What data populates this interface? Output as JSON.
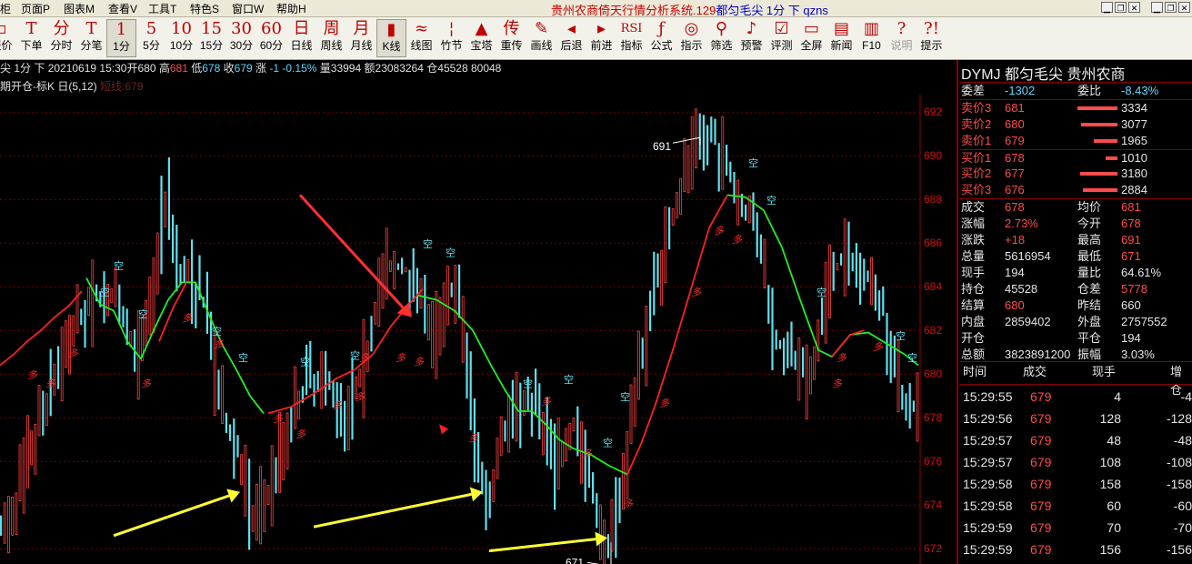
{
  "menu": [
    "柜",
    "页面P",
    "图表M",
    "查看V",
    "工具T",
    "特色S",
    "窗口W",
    "帮助H"
  ],
  "window_title": {
    "main": "贵州农商倚天行情分析系统.129",
    "contract": "都匀毛尖 1分 下 qzns"
  },
  "toolbar": {
    "buttons": [
      {
        "icon": "▫",
        "label": "报价",
        "name": "quote"
      },
      {
        "icon": "T",
        "label": "下单",
        "name": "order"
      },
      {
        "icon": "分",
        "label": "分时",
        "name": "intraday"
      },
      {
        "icon": "T",
        "label": "分笔",
        "name": "ticks"
      },
      {
        "icon": "1",
        "label": "1分",
        "name": "1min",
        "selected": true
      },
      {
        "icon": "5",
        "label": "5分",
        "name": "5min"
      },
      {
        "icon": "10",
        "label": "10分",
        "name": "10min"
      },
      {
        "icon": "15",
        "label": "15分",
        "name": "15min"
      },
      {
        "icon": "30",
        "label": "30分",
        "name": "30min"
      },
      {
        "icon": "60",
        "label": "60分",
        "name": "60min"
      },
      {
        "icon": "日",
        "label": "日线",
        "name": "daily"
      },
      {
        "icon": "周",
        "label": "周线",
        "name": "weekly"
      },
      {
        "icon": "月",
        "label": "月线",
        "name": "monthly"
      },
      {
        "icon": "▮",
        "label": "K线",
        "name": "kline",
        "selected": true
      },
      {
        "icon": "≈",
        "label": "线图",
        "name": "linechart"
      },
      {
        "icon": "¦",
        "label": "竹节",
        "name": "bamboo"
      },
      {
        "icon": "▲",
        "label": "宝塔",
        "name": "tower"
      },
      {
        "icon": "传",
        "label": "重传",
        "name": "reload"
      },
      {
        "icon": "✎",
        "label": "画线",
        "name": "draw"
      },
      {
        "icon": "◂",
        "label": "后退",
        "name": "back"
      },
      {
        "icon": "▸",
        "label": "前进",
        "name": "forward"
      },
      {
        "icon": "RSI",
        "label": "指标",
        "name": "indicator"
      },
      {
        "icon": "ƒ",
        "label": "公式",
        "name": "formula"
      },
      {
        "icon": "◎",
        "label": "指示",
        "name": "signal"
      },
      {
        "icon": "⚲",
        "label": "筛选",
        "name": "filter"
      },
      {
        "icon": "♪",
        "label": "预警",
        "name": "alert"
      },
      {
        "icon": "☑",
        "label": "评测",
        "name": "evaluate"
      },
      {
        "icon": "▭",
        "label": "全屏",
        "name": "fullscreen"
      },
      {
        "icon": "▤",
        "label": "新闻",
        "name": "news"
      },
      {
        "icon": "▥",
        "label": "F10",
        "name": "f10"
      },
      {
        "icon": "?",
        "label": "说明",
        "name": "explain",
        "disabled": true
      },
      {
        "icon": "?!",
        "label": "提示",
        "name": "tips"
      }
    ]
  },
  "infobar": {
    "prefix": "尖 1分 下",
    "date_time": "20210619 15:30",
    "open_label": "开",
    "open": "680",
    "high_label": "高",
    "high": "681",
    "low_label": "低",
    "low": "678",
    "close_label": "收",
    "close": "679",
    "change_label": "涨",
    "change": "-1",
    "change_pct": "-0.15%",
    "volume_label": "量",
    "volume": "33994",
    "amount_label": "额",
    "amount": "23083264",
    "oi_label": "仓",
    "oi": "45528",
    "extra": "80048"
  },
  "indicator_bar": {
    "label": "期开仓-标K 日(5,12)",
    "ghost": "短线:679"
  },
  "chart_data": {
    "type": "candlestick",
    "y_ticks": [
      672,
      674,
      676,
      678,
      680,
      682,
      684,
      686,
      688,
      690,
      692
    ],
    "ylim": [
      671.3,
      692.8
    ],
    "xlim": [
      0,
      1015
    ],
    "high_label": "691",
    "low_label": "671",
    "signal_long": "多",
    "signal_short": "空",
    "price_polyline": [
      [
        0,
        672.8
      ],
      [
        10,
        673.4
      ],
      [
        30,
        676.1
      ],
      [
        50,
        678.8
      ],
      [
        70,
        681.4
      ],
      [
        90,
        682.7
      ],
      [
        110,
        683.8
      ],
      [
        130,
        683.0
      ],
      [
        150,
        680.7
      ],
      [
        165,
        683.3
      ],
      [
        180,
        688.5
      ],
      [
        195,
        684.8
      ],
      [
        210,
        684.2
      ],
      [
        225,
        683.0
      ],
      [
        240,
        678.5
      ],
      [
        260,
        676.5
      ],
      [
        275,
        673.2
      ],
      [
        295,
        674.8
      ],
      [
        320,
        678.2
      ],
      [
        340,
        680.0
      ],
      [
        360,
        679.6
      ],
      [
        380,
        678.2
      ],
      [
        400,
        680.6
      ],
      [
        420,
        684.8
      ],
      [
        440,
        684.9
      ],
      [
        460,
        684.2
      ],
      [
        475,
        681.2
      ],
      [
        490,
        684.2
      ],
      [
        505,
        683.0
      ],
      [
        520,
        677.0
      ],
      [
        535,
        673.8
      ],
      [
        550,
        677.2
      ],
      [
        570,
        679.0
      ],
      [
        590,
        678.6
      ],
      [
        610,
        675.8
      ],
      [
        630,
        677.8
      ],
      [
        650,
        674.5
      ],
      [
        665,
        671.9
      ],
      [
        680,
        674.3
      ],
      [
        700,
        680.0
      ],
      [
        720,
        684.5
      ],
      [
        745,
        688.2
      ],
      [
        765,
        690.9
      ],
      [
        790,
        690.5
      ],
      [
        810,
        688.0
      ],
      [
        830,
        686.8
      ],
      [
        850,
        681.7
      ],
      [
        870,
        680.7
      ],
      [
        890,
        679.4
      ],
      [
        910,
        684.5
      ],
      [
        930,
        685.4
      ],
      [
        950,
        684.6
      ],
      [
        970,
        683.0
      ],
      [
        990,
        679.0
      ],
      [
        1010,
        678.3
      ]
    ],
    "fast_line_green": [
      [
        95,
        684.4
      ],
      [
        110,
        683.2
      ],
      [
        125,
        682.9
      ],
      [
        140,
        681.5
      ],
      [
        155,
        680.7
      ],
      [
        170,
        682.1
      ],
      [
        185,
        683.4
      ],
      [
        200,
        684.2
      ],
      [
        215,
        684.2
      ],
      [
        230,
        682.7
      ],
      [
        245,
        681.3
      ],
      [
        260,
        680.2
      ],
      [
        275,
        679.0
      ],
      [
        290,
        678.2
      ],
      [
        460,
        683.6
      ],
      [
        480,
        683.4
      ],
      [
        500,
        682.9
      ],
      [
        520,
        682.0
      ],
      [
        540,
        680.4
      ],
      [
        555,
        679.3
      ],
      [
        570,
        678.3
      ],
      [
        585,
        678.3
      ],
      [
        600,
        677.7
      ],
      [
        615,
        677.0
      ],
      [
        630,
        676.6
      ],
      [
        650,
        676.3
      ],
      [
        670,
        675.8
      ],
      [
        690,
        675.4
      ],
      [
        800,
        688.2
      ],
      [
        820,
        688.1
      ],
      [
        840,
        687.5
      ],
      [
        860,
        685.8
      ],
      [
        880,
        683.4
      ],
      [
        900,
        681.1
      ],
      [
        915,
        680.8
      ],
      [
        935,
        681.8
      ],
      [
        955,
        681.9
      ],
      [
        975,
        681.4
      ],
      [
        995,
        680.9
      ],
      [
        1010,
        680.4
      ]
    ],
    "fast_line_red": [
      [
        0,
        680.4
      ],
      [
        15,
        680.9
      ],
      [
        30,
        681.5
      ],
      [
        45,
        682.0
      ],
      [
        60,
        682.6
      ],
      [
        75,
        683.1
      ],
      [
        90,
        683.8
      ],
      [
        175,
        681.5
      ],
      [
        190,
        683.0
      ],
      [
        205,
        684.2
      ],
      [
        295,
        678.2
      ],
      [
        320,
        678.5
      ],
      [
        345,
        679.1
      ],
      [
        370,
        679.8
      ],
      [
        390,
        680.2
      ],
      [
        410,
        680.9
      ],
      [
        430,
        682.2
      ],
      [
        450,
        683.2
      ],
      [
        465,
        683.9
      ],
      [
        690,
        675.4
      ],
      [
        705,
        676.8
      ],
      [
        720,
        678.5
      ],
      [
        740,
        681.1
      ],
      [
        760,
        683.9
      ],
      [
        780,
        686.7
      ],
      [
        800,
        688.2
      ],
      [
        915,
        680.8
      ],
      [
        935,
        681.8
      ],
      [
        950,
        682.0
      ]
    ],
    "long_signals": [
      [
        30,
        679.8
      ],
      [
        50,
        679.4
      ],
      [
        75,
        680.8
      ],
      [
        155,
        679.4
      ],
      [
        200,
        682.4
      ],
      [
        235,
        681.2
      ],
      [
        300,
        677.8
      ],
      [
        325,
        677.1
      ],
      [
        365,
        678.4
      ],
      [
        390,
        678.8
      ],
      [
        395,
        680.6
      ],
      [
        435,
        680.6
      ],
      [
        455,
        680.4
      ],
      [
        515,
        676.9
      ],
      [
        595,
        678.6
      ],
      [
        640,
        676.2
      ],
      [
        685,
        673.9
      ],
      [
        725,
        678.5
      ],
      [
        760,
        683.6
      ],
      [
        785,
        686.4
      ],
      [
        805,
        686.0
      ],
      [
        915,
        679.4
      ],
      [
        920,
        680.6
      ],
      [
        960,
        681.1
      ]
    ],
    "short_signals": [
      [
        125,
        684.8
      ],
      [
        110,
        683.6
      ],
      [
        152,
        682.6
      ],
      [
        233,
        681.8
      ],
      [
        262,
        680.6
      ],
      [
        330,
        680.4
      ],
      [
        385,
        680.7
      ],
      [
        465,
        685.8
      ],
      [
        490,
        685.4
      ],
      [
        575,
        679.4
      ],
      [
        620,
        679.6
      ],
      [
        663,
        676.7
      ],
      [
        682,
        678.8
      ],
      [
        823,
        689.5
      ],
      [
        843,
        687.8
      ],
      [
        898,
        683.6
      ],
      [
        985,
        681.6
      ],
      [
        998,
        680.6
      ]
    ],
    "red_arrow": {
      "from": [
        330,
        688.2
      ],
      "to": [
        453,
        682.6
      ]
    },
    "yellow_arrows": [
      {
        "from": [
          125,
          672.6
        ],
        "to": [
          264,
          674.6
        ]
      },
      {
        "from": [
          345,
          673.0
        ],
        "to": [
          531,
          674.6
        ]
      },
      {
        "from": [
          538,
          671.9
        ],
        "to": [
          668,
          672.5
        ]
      }
    ],
    "cursor_marker": [
      483,
      677.7
    ]
  },
  "panel": {
    "title": "DYMJ  都匀毛尖  贵州农商",
    "weicha_label": "委差",
    "weicha": "-1302",
    "weibi_label": "委比",
    "weibi": "-8.43%",
    "asks": [
      {
        "label": "卖价3",
        "price": "681",
        "vol": "3334",
        "pct": 0.78
      },
      {
        "label": "卖价2",
        "price": "680",
        "vol": "3077",
        "pct": 0.72
      },
      {
        "label": "卖价1",
        "price": "679",
        "vol": "1965",
        "pct": 0.46
      }
    ],
    "bids": [
      {
        "label": "买价1",
        "price": "678",
        "vol": "1010",
        "pct": 0.24
      },
      {
        "label": "买价2",
        "price": "677",
        "vol": "3180",
        "pct": 0.74
      },
      {
        "label": "买价3",
        "price": "676",
        "vol": "2884",
        "pct": 0.67
      }
    ],
    "stats": [
      {
        "k": "成交",
        "v": "678",
        "vc": "red",
        "k2": "均价",
        "v2": "681",
        "v2c": "red"
      },
      {
        "k": "涨幅",
        "v": "2.73%",
        "vc": "red",
        "k2": "今开",
        "v2": "678",
        "v2c": "red"
      },
      {
        "k": "涨跌",
        "v": "+18",
        "vc": "red",
        "k2": "最高",
        "v2": "691",
        "v2c": "red"
      },
      {
        "k": "总量",
        "v": "5616954",
        "vc": "white",
        "k2": "最低",
        "v2": "671",
        "v2c": "red"
      },
      {
        "k": "现手",
        "v": "194",
        "vc": "white",
        "k2": "量比",
        "v2": "64.61%",
        "v2c": "white"
      },
      {
        "k": "持仓",
        "v": "45528",
        "vc": "white",
        "k2": "仓差",
        "v2": "5778",
        "v2c": "red"
      },
      {
        "k": "结算",
        "v": "680",
        "vc": "red",
        "k2": "昨结",
        "v2": "660",
        "v2c": "white"
      },
      {
        "k": "内盘",
        "v": "2859402",
        "vc": "white",
        "k2": "外盘",
        "v2": "2757552",
        "v2c": "white"
      },
      {
        "k": "开仓",
        "v": "",
        "vc": "white",
        "k2": "平仓",
        "v2": "194",
        "v2c": "white"
      },
      {
        "k": "总额",
        "v": "3823891200",
        "vc": "white",
        "k2": "振幅",
        "v2": "3.03%",
        "v2c": "white"
      }
    ],
    "tick_header": {
      "time": "时间",
      "price": "成交",
      "vol": "现手",
      "oi": "增仓"
    },
    "ticks": [
      {
        "time": "15:29:55",
        "price": "679",
        "vol": "4",
        "oi": "-4"
      },
      {
        "time": "15:29:56",
        "price": "679",
        "vol": "128",
        "oi": "-128"
      },
      {
        "time": "15:29:57",
        "price": "679",
        "vol": "48",
        "oi": "-48"
      },
      {
        "time": "15:29:57",
        "price": "679",
        "vol": "108",
        "oi": "-108"
      },
      {
        "time": "15:29:58",
        "price": "679",
        "vol": "158",
        "oi": "-158"
      },
      {
        "time": "15:29:58",
        "price": "679",
        "vol": "60",
        "oi": "-60"
      },
      {
        "time": "15:29:59",
        "price": "679",
        "vol": "70",
        "oi": "-70"
      },
      {
        "time": "15:29:59",
        "price": "679",
        "vol": "156",
        "oi": "-156"
      }
    ]
  }
}
